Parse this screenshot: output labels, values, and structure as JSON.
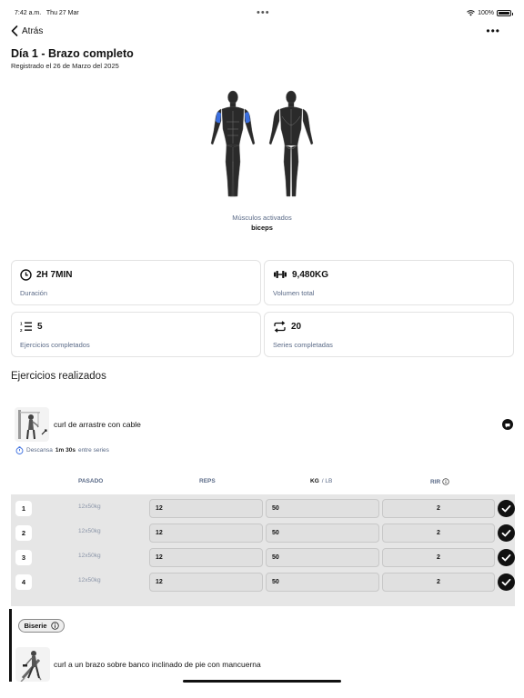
{
  "status_bar": {
    "time": "7:42 a.m.",
    "date": "Thu 27 Mar",
    "battery": "100%",
    "battery_level": 1.0
  },
  "nav": {
    "back_label": "Atrás"
  },
  "workout": {
    "title": "Día 1 - Brazo completo",
    "registered": "Registrado el 26 de Marzo del 2025"
  },
  "muscles": {
    "label": "Músculos activados",
    "value": "biceps",
    "highlight_color": "#3b6fe0"
  },
  "stats": [
    {
      "icon": "clock-icon",
      "value": "2H 7MIN",
      "label": "Duración"
    },
    {
      "icon": "dumbbell-icon",
      "value": "9,480KG",
      "label": "Volumen total"
    },
    {
      "icon": "numbered-list-icon",
      "value": "5",
      "label": "Ejercicios completados"
    },
    {
      "icon": "repeat-icon",
      "value": "20",
      "label": "Series completadas"
    }
  ],
  "section_title": "Ejercicios realizados",
  "exercise1": {
    "name": "curl de arrastre con cable",
    "rest_prefix": "Descansa",
    "rest_value": "1m 30s",
    "rest_suffix": "entre series"
  },
  "table": {
    "col_prev": "PASADO",
    "col_reps": "REPS",
    "col_kg": "KG",
    "col_unit_sep": "/ LB",
    "col_rir": "RIR"
  },
  "sets": [
    {
      "num": "1",
      "prev": "12x50kg",
      "reps": "12",
      "kg": "50",
      "rir": "2",
      "done": true
    },
    {
      "num": "2",
      "prev": "12x50kg",
      "reps": "12",
      "kg": "50",
      "rir": "2",
      "done": true
    },
    {
      "num": "3",
      "prev": "12x50kg",
      "reps": "12",
      "kg": "50",
      "rir": "2",
      "done": true
    },
    {
      "num": "4",
      "prev": "12x50kg",
      "reps": "12",
      "kg": "50",
      "rir": "2",
      "done": true
    }
  ],
  "biserie_label": "Biserie",
  "exercise2": {
    "name": "curl a un brazo sobre banco inclinado de pie con mancuerna"
  }
}
